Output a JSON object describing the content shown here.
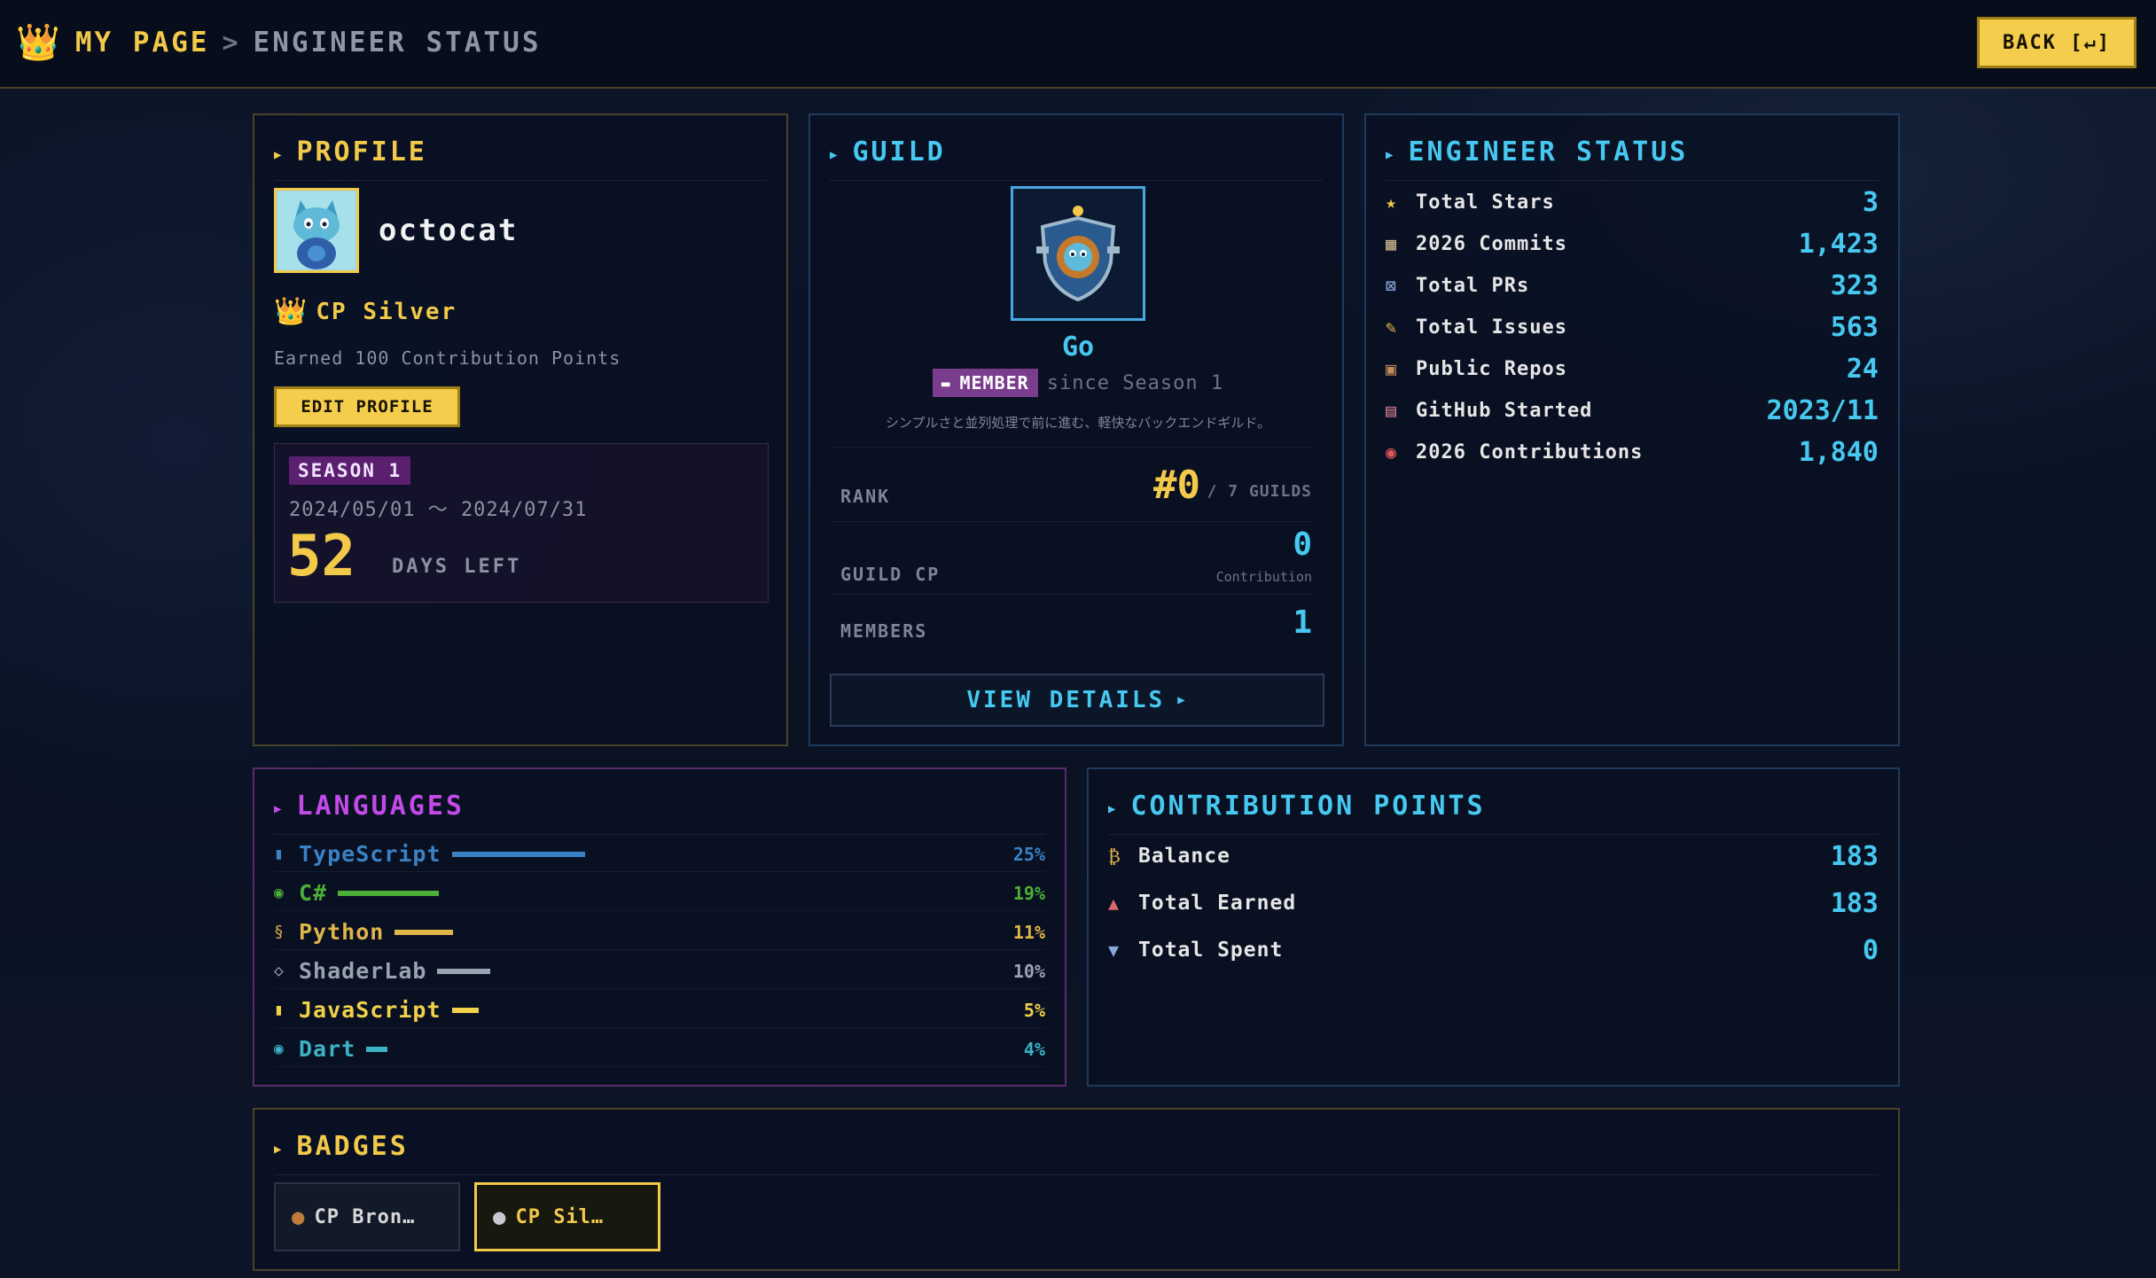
{
  "header": {
    "crown_icon": "crown-icon",
    "my_page": "MY PAGE",
    "separator": ">",
    "current": "ENGINEER STATUS",
    "back_label": "BACK [↵]"
  },
  "profile": {
    "title": "PROFILE",
    "username": "octocat",
    "cp_rank": "CP Silver",
    "earned_text": "Earned 100 Contribution Points",
    "edit_label": "EDIT PROFILE",
    "season": {
      "tag": "SEASON 1",
      "dates": "2024/05/01 ～ 2024/07/31",
      "days": "52",
      "days_label": "DAYS LEFT"
    }
  },
  "guild": {
    "title": "GUILD",
    "name": "Go",
    "member_tag": "MEMBER",
    "since": "since Season 1",
    "description": "シンプルさと並列処理で前に進む、軽快なバックエンドギルド。",
    "rank_label": "RANK",
    "rank_value": "#0",
    "rank_of": "/ 7 GUILDS",
    "cp_label": "GUILD CP",
    "cp_value": "0",
    "cp_sub": "Contribution",
    "members_label": "MEMBERS",
    "members_value": "1",
    "view_label": "VIEW DETAILS"
  },
  "engineer": {
    "title": "ENGINEER STATUS",
    "stats": [
      {
        "icon": "star-icon",
        "glyph": "★",
        "label": "Total Stars",
        "value": "3"
      },
      {
        "icon": "commit-icon",
        "glyph": "▦",
        "label": "2026 Commits",
        "value": "1,423"
      },
      {
        "icon": "pr-icon",
        "glyph": "⊠",
        "label": "Total PRs",
        "value": "323"
      },
      {
        "icon": "issue-icon",
        "glyph": "✎",
        "label": "Total Issues",
        "value": "563"
      },
      {
        "icon": "repo-icon",
        "glyph": "▣",
        "label": "Public Repos",
        "value": "24"
      },
      {
        "icon": "calendar-icon",
        "glyph": "▤",
        "label": "GitHub Started",
        "value": "2023/11"
      },
      {
        "icon": "contribution-icon",
        "glyph": "◉",
        "label": "2026 Contributions",
        "value": "1,840"
      }
    ]
  },
  "languages": {
    "title": "LANGUAGES",
    "items": [
      {
        "name": "TypeScript",
        "percent": "25%",
        "share": 0.25,
        "color": "#3b82c4",
        "glyph": "▮"
      },
      {
        "name": "C#",
        "percent": "19%",
        "share": 0.19,
        "color": "#4caf37",
        "glyph": "◉"
      },
      {
        "name": "Python",
        "percent": "11%",
        "share": 0.11,
        "color": "#e0b54a",
        "glyph": "§"
      },
      {
        "name": "ShaderLab",
        "percent": "10%",
        "share": 0.1,
        "color": "#9aa3b2",
        "glyph": "◇"
      },
      {
        "name": "JavaScript",
        "percent": "5%",
        "share": 0.05,
        "color": "#f1d14a",
        "glyph": "▮"
      },
      {
        "name": "Dart",
        "percent": "4%",
        "share": 0.04,
        "color": "#3bb3c4",
        "glyph": "◉"
      }
    ]
  },
  "cp": {
    "title": "CONTRIBUTION POINTS",
    "rows": [
      {
        "icon": "money-bag-icon",
        "glyph": "₿",
        "label": "Balance",
        "value": "183"
      },
      {
        "icon": "chart-up-icon",
        "glyph": "▲",
        "label": "Total Earned",
        "value": "183"
      },
      {
        "icon": "chart-down-icon",
        "glyph": "▼",
        "label": "Total Spent",
        "value": "0"
      }
    ]
  },
  "badges": {
    "title": "BADGES",
    "items": [
      {
        "label": "CP Bron…",
        "icon": "bronze-medal-icon"
      },
      {
        "label": "CP Sil…",
        "icon": "silver-medal-icon"
      }
    ]
  },
  "colors": {
    "gold": "#f3c94a",
    "cyan": "#47c8f0",
    "purple": "#c34ae8",
    "background": "#0b1326"
  }
}
